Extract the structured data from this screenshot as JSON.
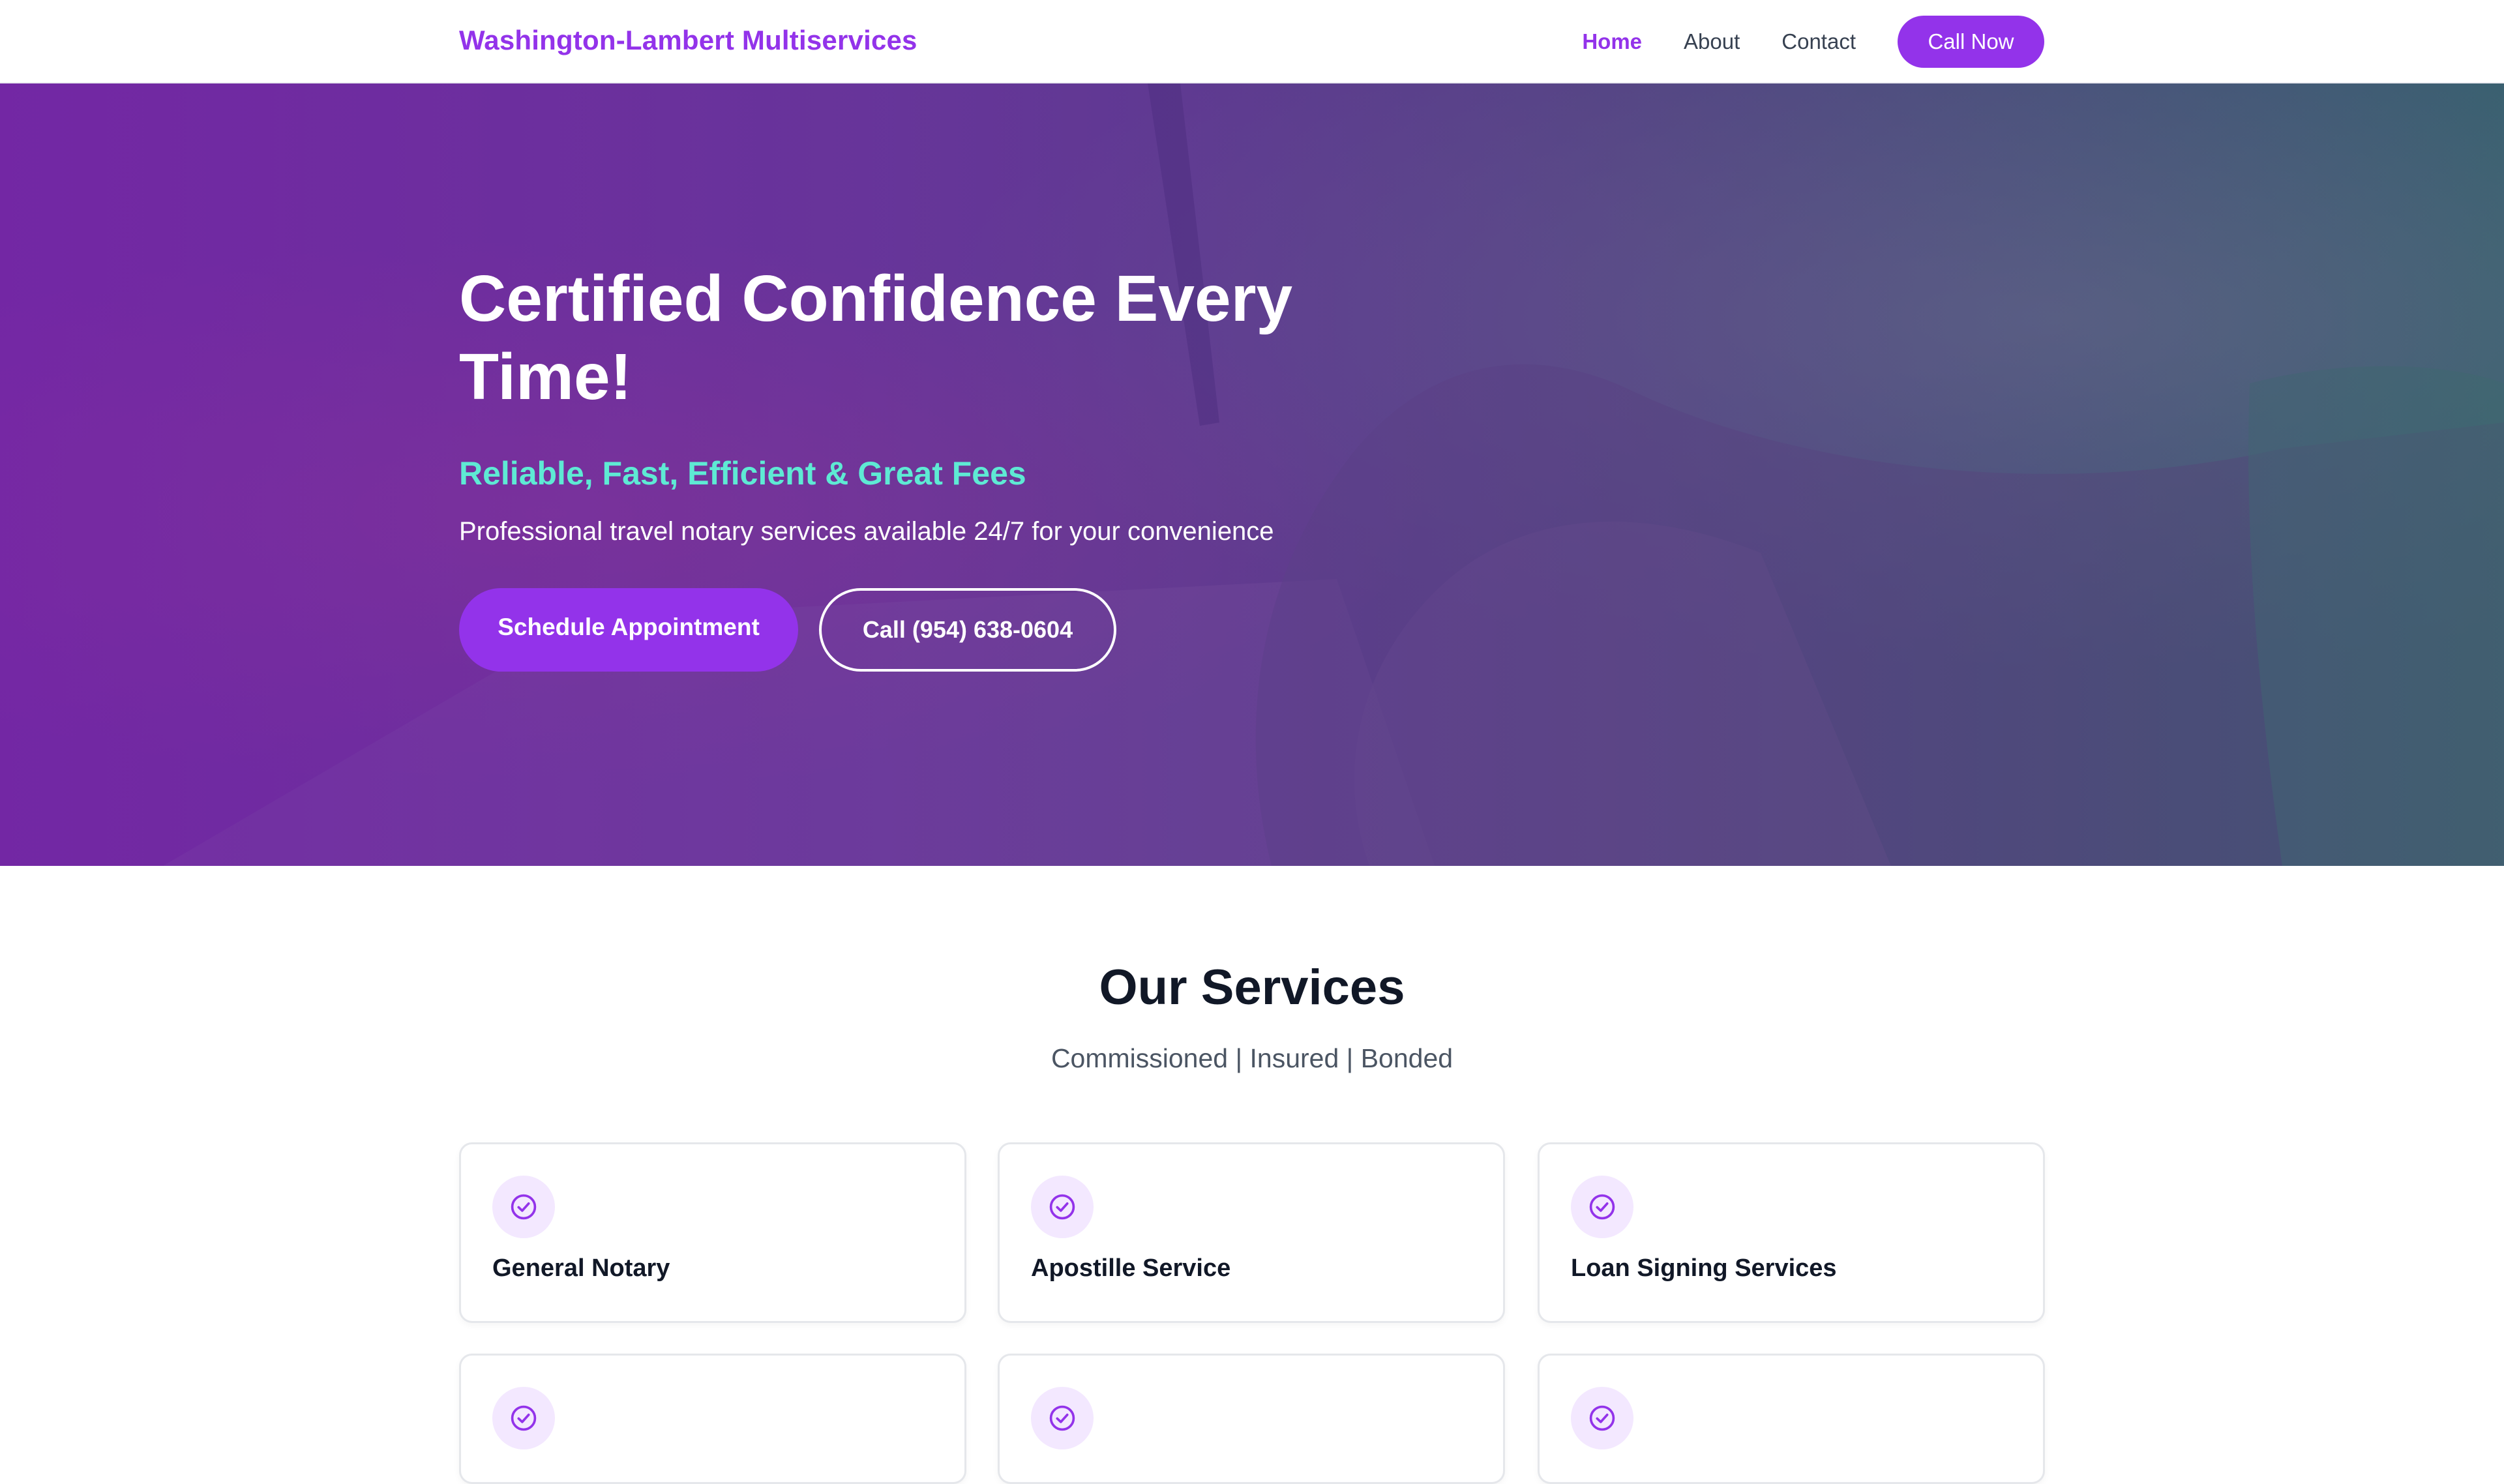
{
  "header": {
    "brand": "Washington-Lambert Multiservices",
    "nav": {
      "home": "Home",
      "about": "About",
      "contact": "Contact",
      "call_now": "Call Now"
    }
  },
  "hero": {
    "title": "Certified Confidence Every Time!",
    "subtitle": "Reliable, Fast, Efficient & Great Fees",
    "text": "Professional travel notary services available 24/7 for your convenience",
    "primary_button": "Schedule Appointment",
    "secondary_button": "Call (954) 638-0604"
  },
  "services": {
    "title": "Our Services",
    "subtitle": "Commissioned | Insured | Bonded",
    "cards": [
      {
        "title": "General Notary",
        "icon": "check-circle-icon"
      },
      {
        "title": "Apostille Service",
        "icon": "check-circle-icon"
      },
      {
        "title": "Loan Signing Services",
        "icon": "check-circle-icon"
      }
    ]
  },
  "colors": {
    "brand": "#9333ea",
    "accent": "#5eead4",
    "icon_bg": "#f3e8ff"
  }
}
